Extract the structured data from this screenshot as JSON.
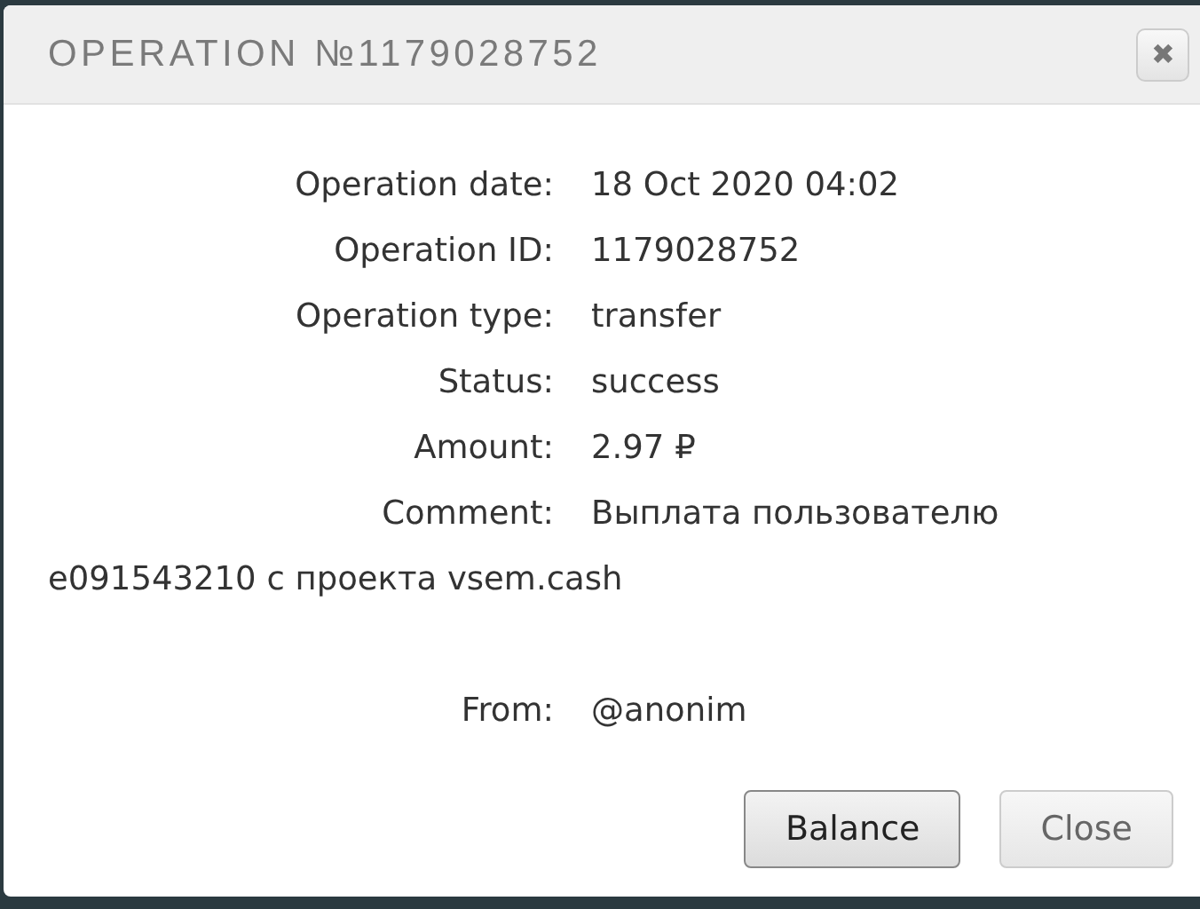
{
  "dialog": {
    "title": "OPERATION №1179028752",
    "close_icon": "✖"
  },
  "fields": [
    {
      "label": "Operation date:",
      "value": "18 Oct 2020 04:02"
    },
    {
      "label": "Operation ID:",
      "value": "1179028752"
    },
    {
      "label": "Operation type:",
      "value": "transfer"
    },
    {
      "label": "Status:",
      "value": "success"
    },
    {
      "label": "Amount:",
      "value": "2.97 ₽"
    },
    {
      "label": "Comment:",
      "value": "Выплата пользователю",
      "continuation": "e091543210 с проекта vsem.cash"
    },
    {
      "label": "From:",
      "value": "@anonim"
    }
  ],
  "buttons": [
    {
      "label": "Balance",
      "disabled": false
    },
    {
      "label": "Close",
      "disabled": true
    }
  ]
}
